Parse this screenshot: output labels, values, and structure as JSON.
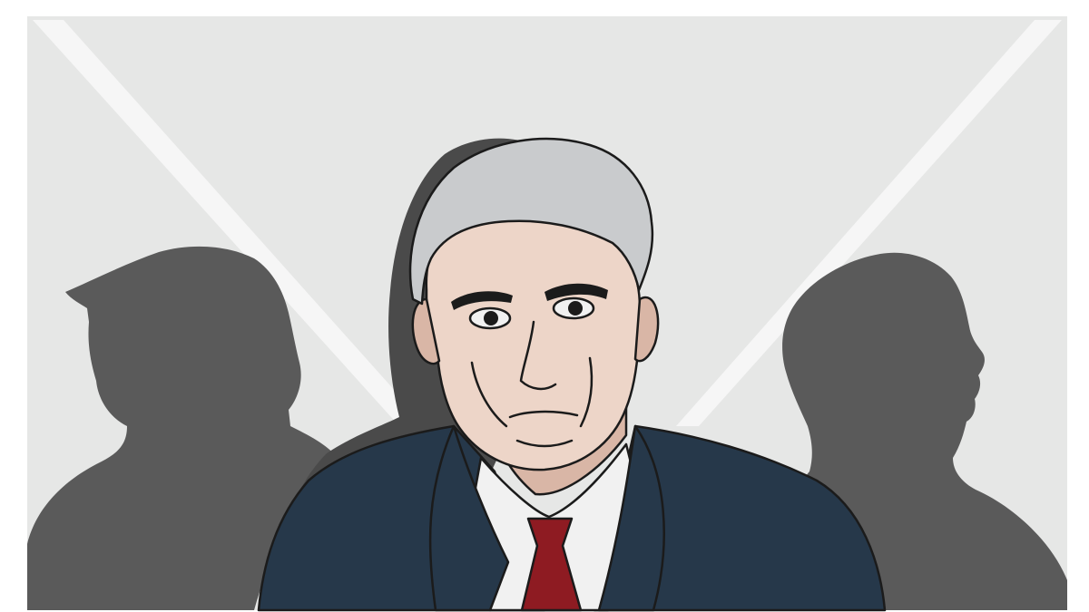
{
  "image": {
    "kind": "editorial illustration",
    "colors": {
      "frame": "#ffffff",
      "background": "#e6e7e6",
      "light_beam": "#f6f6f6",
      "silhouette": "#5a5a5a",
      "silhouette_shadow": "#4a4a4a",
      "hair": "#c9cbcd",
      "skin": "#edd5c8",
      "skin_shade": "#d9b6a6",
      "suit": "#26384a",
      "shirt": "#f1f1f1",
      "tie": "#8e1b22",
      "outline": "#1b1b1b"
    },
    "elements": [
      "left-silhouette",
      "right-silhouette",
      "spotlight-beams",
      "central-figure"
    ]
  }
}
